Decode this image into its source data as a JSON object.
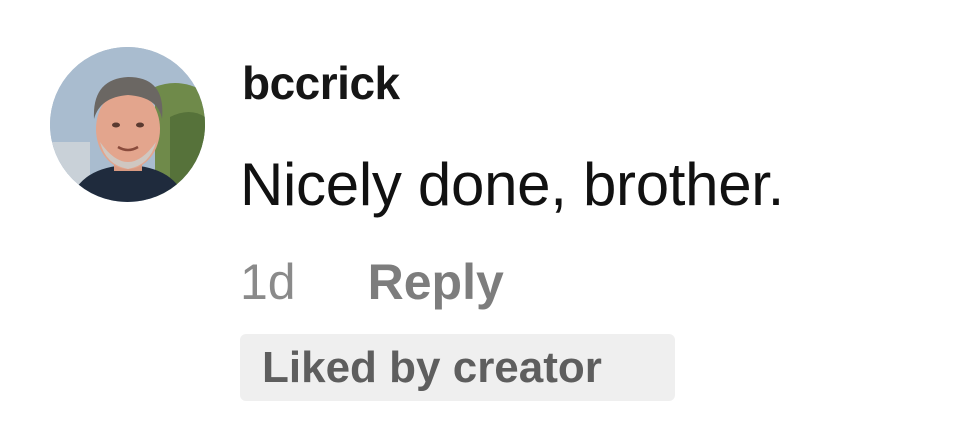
{
  "comment": {
    "username": "bccrick",
    "text": "Nicely done, brother.",
    "timestamp": "1d",
    "reply_label": "Reply",
    "badge_label": "Liked by creator"
  },
  "avatar": {
    "icon": "user-avatar-photo"
  }
}
